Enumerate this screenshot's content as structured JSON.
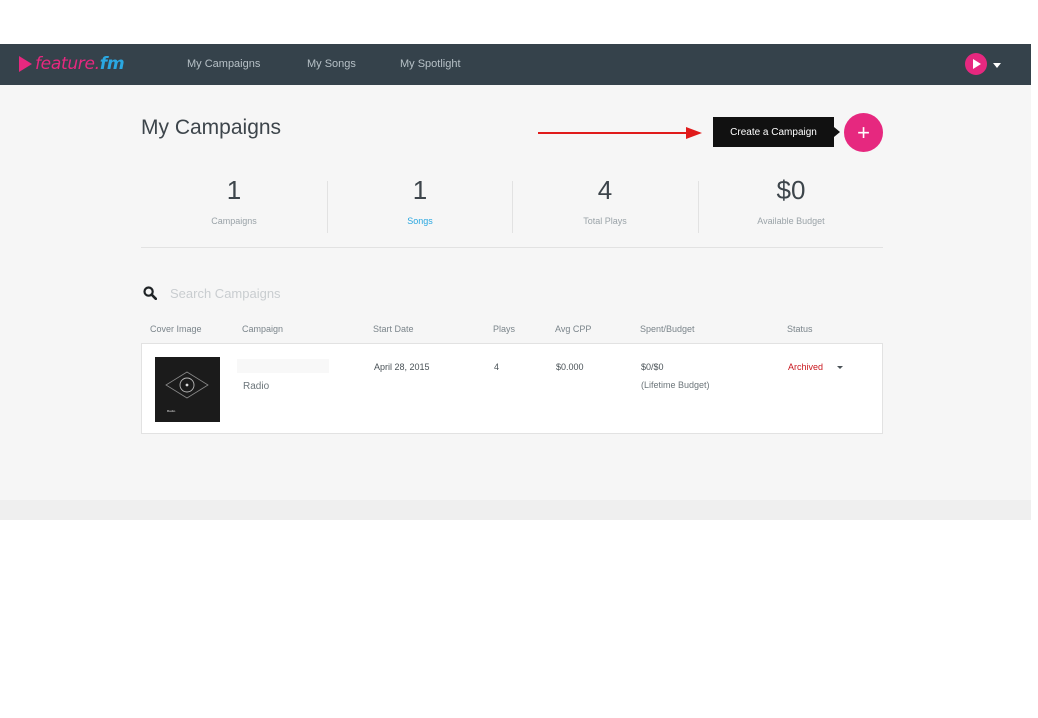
{
  "brand": {
    "logo_prefix": "feature.",
    "logo_suffix": "fm"
  },
  "nav": {
    "items": [
      {
        "label": "My Campaigns"
      },
      {
        "label": "My Songs"
      },
      {
        "label": "My Spotlight"
      }
    ]
  },
  "header": {
    "title": "My Campaigns",
    "tooltip": "Create a Campaign",
    "create_symbol": "+"
  },
  "stats": [
    {
      "value": "1",
      "label": "Campaigns"
    },
    {
      "value": "1",
      "label": "Songs"
    },
    {
      "value": "4",
      "label": "Total Plays"
    },
    {
      "value": "$0",
      "label": "Available Budget"
    }
  ],
  "search": {
    "placeholder": "Search Campaigns",
    "value": ""
  },
  "table": {
    "columns": [
      "Cover Image",
      "Campaign",
      "Start Date",
      "Plays",
      "Avg CPP",
      "Spent/Budget",
      "Status"
    ],
    "rows": [
      {
        "cover_caption": "Radio",
        "campaign": "Radio",
        "start_date": "April 28, 2015",
        "plays": "4",
        "avg_cpp": "$0.000",
        "spent_budget": "$0/$0",
        "budget_note": "(Lifetime Budget)",
        "status": "Archived"
      }
    ]
  },
  "colors": {
    "accent": "#e6287f",
    "link": "#2aa7e0",
    "navbar": "#35424b",
    "status_archived": "#c9171e",
    "annotation_arrow": "#e01b1b"
  },
  "icons": {
    "logo": "play-triangle-icon",
    "search": "search-icon",
    "avatar": "play-triangle-icon",
    "dropdown": "caret-down-icon"
  }
}
